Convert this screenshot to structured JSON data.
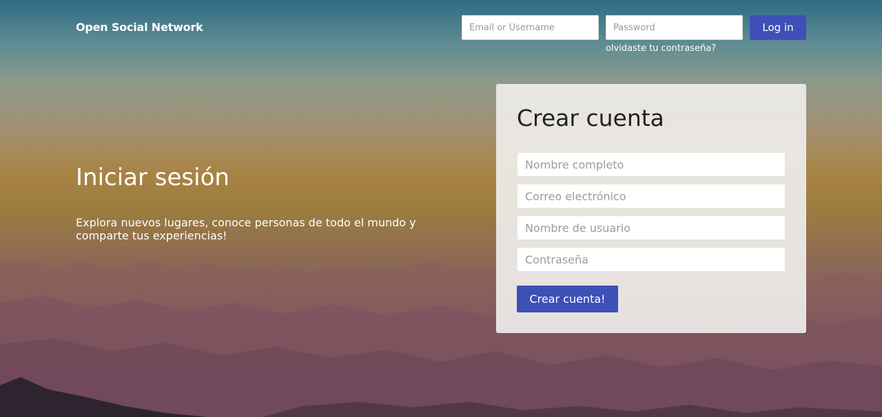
{
  "header": {
    "brand": "Open Social Network",
    "email_placeholder": "Email or Username",
    "password_placeholder": "Password",
    "login_label": "Log in",
    "forgot_label": "olvidaste tu contraseña?"
  },
  "hero": {
    "title": "Iniciar sesión",
    "text": "Explora nuevos lugares, conoce personas de todo el mundo y comparte tus experiencias!"
  },
  "signup": {
    "title": "Crear cuenta",
    "fullname_placeholder": "Nombre completo",
    "email_placeholder": "Correo electrónico",
    "username_placeholder": "Nombre de usuario",
    "password_placeholder": "Contraseña",
    "submit_label": "Crear cuenta!"
  },
  "colors": {
    "accent": "#3f4fb8",
    "panel": "#eeecea"
  }
}
